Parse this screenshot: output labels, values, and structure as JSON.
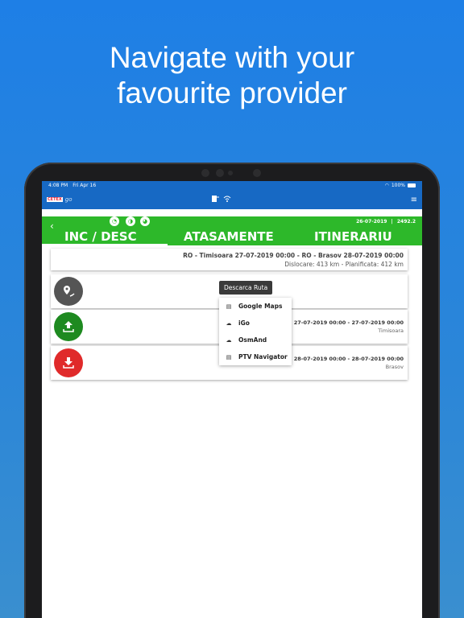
{
  "headline": {
    "line1": "Navigate with your",
    "line2": "favourite provider"
  },
  "status_bar": {
    "time": "4:08 PM",
    "date": "Fri Apr 16",
    "battery": "100%"
  },
  "app": {
    "logo_text": "CETEX",
    "logo_suffix": "go",
    "menu_icon": "hamburger-icon"
  },
  "tabs": {
    "items": [
      {
        "label": "INC / DESC",
        "active": true
      },
      {
        "label": "ATASAMENTE"
      },
      {
        "label": "ITINERARIU"
      }
    ],
    "date": "26-07-2019",
    "separator": "|",
    "number": "2492.2"
  },
  "route": {
    "title": "RO - Timisoara 27-07-2019 00:00 - RO - Brasov 28-07-2019 00:00",
    "subtitle": "Dislocare: 413 km - Planificata: 412 km"
  },
  "rows": [
    {
      "icon": "map-route-icon",
      "color": "#555555"
    },
    {
      "icon": "upload-icon",
      "color": "#1e8a20",
      "dates": "27-07-2019 00:00 - 27-07-2019 00:00",
      "city": "Timisoara"
    },
    {
      "icon": "download-icon",
      "color": "#e02a2a",
      "dates": "28-07-2019 00:00 - 28-07-2019 00:00",
      "city": "Brasov"
    }
  ],
  "tooltip": "Descarca Ruta",
  "menu": [
    {
      "label": "Google Maps",
      "icon": "map-icon"
    },
    {
      "label": "iGo",
      "icon": "cloud-icon"
    },
    {
      "label": "OsmAnd",
      "icon": "cloud-icon"
    },
    {
      "label": "PTV Navigator",
      "icon": "map-icon"
    }
  ]
}
